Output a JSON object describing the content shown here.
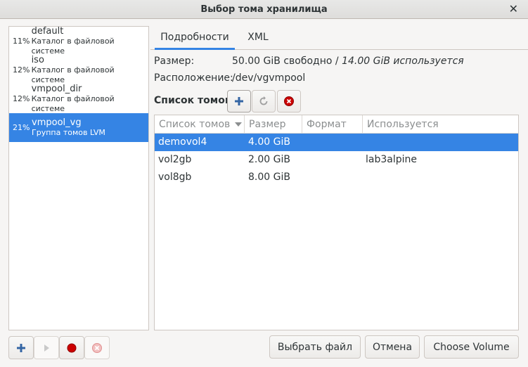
{
  "window": {
    "title": "Выбор тома хранилища",
    "close_glyph": "✕"
  },
  "pools": [
    {
      "pct": "11%",
      "name": "default",
      "desc": "Каталог в файловой системе",
      "selected": false
    },
    {
      "pct": "12%",
      "name": "iso",
      "desc": "Каталог в файловой системе",
      "selected": false
    },
    {
      "pct": "12%",
      "name": "vmpool_dir",
      "desc": "Каталог в файловой системе",
      "selected": false
    },
    {
      "pct": "21%",
      "name": "vmpool_vg",
      "desc": "Группа томов LVM",
      "selected": true
    }
  ],
  "tabs": [
    {
      "label": "Подробности",
      "active": true
    },
    {
      "label": "XML",
      "active": false
    }
  ],
  "details": {
    "size_label": "Размер:",
    "size_free": "50.00 GiB свободно",
    "size_sep": " / ",
    "size_used": "14.00 GiB используется",
    "location_label": "Расположение:",
    "location_value": "/dev/vgvmpool",
    "volumes_label": "Список томов"
  },
  "table": {
    "headers": [
      "Список томов",
      "Размер",
      "Формат",
      "Используется"
    ],
    "rows": [
      {
        "name": "demovol4",
        "size": "4.00 GiB",
        "format": "",
        "used_by": "",
        "selected": true
      },
      {
        "name": "vol2gb",
        "size": "2.00 GiB",
        "format": "",
        "used_by": "lab3alpine",
        "selected": false
      },
      {
        "name": "vol8gb",
        "size": "8.00 GiB",
        "format": "",
        "used_by": "",
        "selected": false
      }
    ]
  },
  "buttons": {
    "browse_file": "Выбрать файл",
    "cancel": "Отмена",
    "choose_volume": "Choose Volume"
  },
  "colors": {
    "accent": "#3584e4",
    "stop_red": "#cc0000"
  }
}
